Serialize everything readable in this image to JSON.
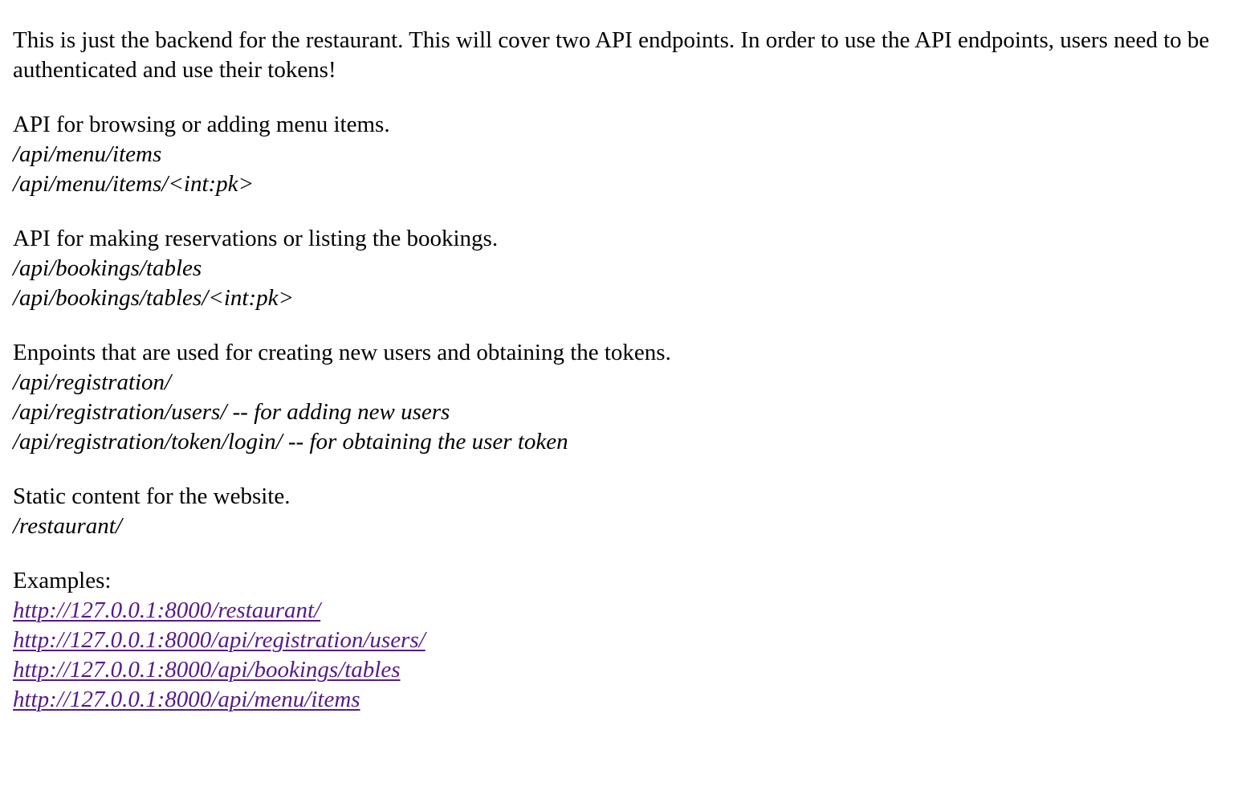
{
  "intro": "This is just the backend for the restaurant. This will cover two API endpoints. In order to use the API endpoints, users need to be authenticated and use their tokens!",
  "sections": [
    {
      "heading": "API for browsing or adding menu items.",
      "paths": [
        "/api/menu/items",
        "/api/menu/items/<int:pk>"
      ]
    },
    {
      "heading": "API for making reservations or listing the bookings.",
      "paths": [
        "/api/bookings/tables",
        "/api/bookings/tables/<int:pk>"
      ]
    },
    {
      "heading": "Enpoints that are used for creating new users and obtaining the tokens.",
      "paths": [
        "/api/registration/",
        "/api/registration/users/ -- for adding new users",
        "/api/registration/token/login/ -- for obtaining the user token"
      ]
    },
    {
      "heading": "Static content for the website.",
      "paths": [
        "/restaurant/"
      ]
    }
  ],
  "examples": {
    "heading": "Examples:",
    "links": [
      "http://127.0.0.1:8000/restaurant/",
      "http://127.0.0.1:8000/api/registration/users/",
      "http://127.0.0.1:8000/api/bookings/tables",
      "http://127.0.0.1:8000/api/menu/items"
    ]
  },
  "colors": {
    "text": "#000000",
    "visited_link": "#551a8b",
    "background": "#ffffff"
  }
}
